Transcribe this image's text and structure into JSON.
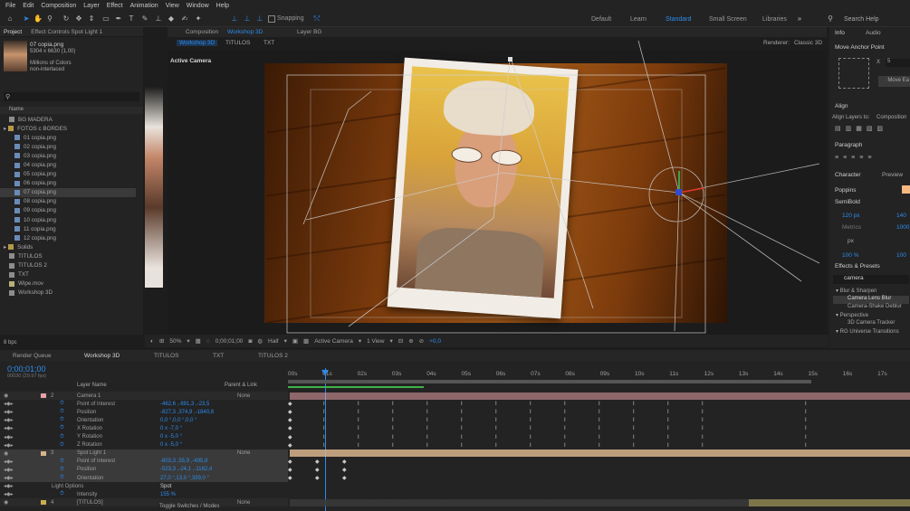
{
  "menu": [
    "File",
    "Edit",
    "Composition",
    "Layer",
    "Effect",
    "Animation",
    "View",
    "Window",
    "Help"
  ],
  "toolbar": {
    "snapping": "Snapping",
    "workspaces": [
      "Default",
      "Learn",
      "Standard",
      "Small Screen",
      "Libraries"
    ],
    "active_workspace": "Standard",
    "search_help": "Search Help"
  },
  "project": {
    "tab": "Project",
    "effect_controls_tab": "Effect Controls Spot Light 1",
    "thumb_name": "07 copia.png",
    "thumb_dims": "5304 x 6630 (1,00)",
    "thumb_color": "Millions of Colors",
    "thumb_interlace": "non-interlaced",
    "search_placeholder": "",
    "column_name": "Name",
    "items": [
      {
        "label": "BG MADERA",
        "type": "comp",
        "indent": 1
      },
      {
        "label": "FOTOS c BORDES",
        "type": "folder",
        "indent": 0
      },
      {
        "label": "01 copia.png",
        "type": "img",
        "indent": 2
      },
      {
        "label": "02 copia.png",
        "type": "img",
        "indent": 2
      },
      {
        "label": "03 copia.png",
        "type": "img",
        "indent": 2
      },
      {
        "label": "04 copia.png",
        "type": "img",
        "indent": 2
      },
      {
        "label": "05 copia.png",
        "type": "img",
        "indent": 2
      },
      {
        "label": "06 copia.png",
        "type": "img",
        "indent": 2
      },
      {
        "label": "07 copia.png",
        "type": "img",
        "indent": 2,
        "selected": true
      },
      {
        "label": "08 copia.png",
        "type": "img",
        "indent": 2
      },
      {
        "label": "09 copia.png",
        "type": "img",
        "indent": 2
      },
      {
        "label": "10 copia.png",
        "type": "img",
        "indent": 2
      },
      {
        "label": "11 copia.png",
        "type": "img",
        "indent": 2
      },
      {
        "label": "12 copia.png",
        "type": "img",
        "indent": 2
      },
      {
        "label": "Solids",
        "type": "folder",
        "indent": 0
      },
      {
        "label": "TITULOS",
        "type": "comp",
        "indent": 1
      },
      {
        "label": "TITULOS 2",
        "type": "comp",
        "indent": 1
      },
      {
        "label": "TXT",
        "type": "comp",
        "indent": 1
      },
      {
        "label": "Wipe.mov",
        "type": "mov",
        "indent": 1
      },
      {
        "label": "Workshop 3D",
        "type": "comp",
        "indent": 1
      }
    ],
    "bpc": "8 bpc"
  },
  "composition": {
    "tab_label": "Composition",
    "tab_name": "Workshop 3D",
    "layer_tab": "Layer BG",
    "breadcrumbs": [
      "Workshop 3D",
      "TITULOS",
      "TXT"
    ],
    "renderer_label": "Renderer:",
    "renderer_value": "Classic 3D",
    "active_camera": "Active Camera",
    "footer": {
      "zoom": "50%",
      "timecode": "0;00;01;00",
      "resolution": "Half",
      "camera": "Active Camera",
      "views": "1 View",
      "exposure": "+0,0"
    }
  },
  "right_panel": {
    "info_tab": "Info",
    "audio_tab": "Audio",
    "anchor_title": "Move Anchor Point",
    "anchor_x": "X",
    "anchor_x_val": "5",
    "anchor_button": "Move Ea",
    "align_title": "Align",
    "align_to_label": "Align Layers to:",
    "align_to_value": "Composition",
    "paragraph_title": "Paragraph",
    "character_title": "Character",
    "preview_tab": "Preview",
    "font_family": "Poppins",
    "font_style": "SemiBold",
    "font_size": "120 px",
    "leading": "140",
    "tracking": "1000",
    "metrics": "Metrics",
    "px_unit": "px",
    "scale_v": "100 %",
    "scale_h": "100",
    "effects_title": "Effects & Presets",
    "effects_search": "camera",
    "effects_tree": [
      {
        "label": "Blur & Sharpen",
        "level": 0
      },
      {
        "label": "Camera Lens Blur",
        "level": 1,
        "selected": true
      },
      {
        "label": "Camera-Shake Deblur",
        "level": 1
      },
      {
        "label": "Perspective",
        "level": 0
      },
      {
        "label": "3D Camera Tracker",
        "level": 1
      },
      {
        "label": "RG Universe Transitions",
        "level": 0
      }
    ]
  },
  "timeline": {
    "tabs": [
      "Render Queue",
      "Workshop 3D",
      "TITULOS",
      "TXT",
      "TITULOS 2"
    ],
    "active_tab": "Workshop 3D",
    "timecode": "0;00;01;00",
    "frame_info": "00030 (29.97 fps)",
    "col_layer_name": "Layer Name",
    "col_parent": "Parent & Link",
    "ruler": [
      "00s",
      "01s",
      "02s",
      "03s",
      "04s",
      "05s",
      "06s",
      "07s",
      "08s",
      "09s",
      "10s",
      "11s",
      "12s",
      "13s",
      "14s",
      "15s",
      "16s",
      "17s"
    ],
    "rows": [
      {
        "kind": "layer",
        "num": "2",
        "name": "Camera 1",
        "parent": "None"
      },
      {
        "kind": "prop",
        "name": "Point of Interest",
        "value": "-462,6 ,-891,3 ,-23,5"
      },
      {
        "kind": "prop",
        "name": "Position",
        "value": "-827,3 ,374,9 ,-1840,8"
      },
      {
        "kind": "prop",
        "name": "Orientation",
        "value": "0,0 °,0,0 °,0,0 °"
      },
      {
        "kind": "prop",
        "name": "X Rotation",
        "value": "0 x -7,0 °"
      },
      {
        "kind": "prop",
        "name": "Y Rotation",
        "value": "0 x -5,0 °"
      },
      {
        "kind": "prop",
        "name": "Z Rotation",
        "value": "0 x -5,0 °"
      },
      {
        "kind": "layer",
        "num": "3",
        "name": "Spot Light 1",
        "parent": "None",
        "selected": true
      },
      {
        "kind": "prop",
        "name": "Point of Interest",
        "value": "-603,3 ,55,9 ,-495,8",
        "selected": true
      },
      {
        "kind": "prop",
        "name": "Position",
        "value": "-523,3 ,-24,1 ,-1162,4",
        "selected": true
      },
      {
        "kind": "prop",
        "name": "Orientation",
        "value": "27,0 °,13,0 °,339,0 °",
        "selected": true
      },
      {
        "kind": "group",
        "name": "Light Options",
        "value": "Spot"
      },
      {
        "kind": "prop",
        "name": "Intensity",
        "value": "155 %"
      },
      {
        "kind": "layer",
        "num": "4",
        "name": "[TITULOS]",
        "parent": "None"
      }
    ],
    "footer": "Toggle Switches / Modes"
  },
  "colors": {
    "accent": "#2d8ceb",
    "camera_label": "#e8a0a8",
    "light_label": "#d8b48c",
    "titulos_label": "#c8b050"
  }
}
